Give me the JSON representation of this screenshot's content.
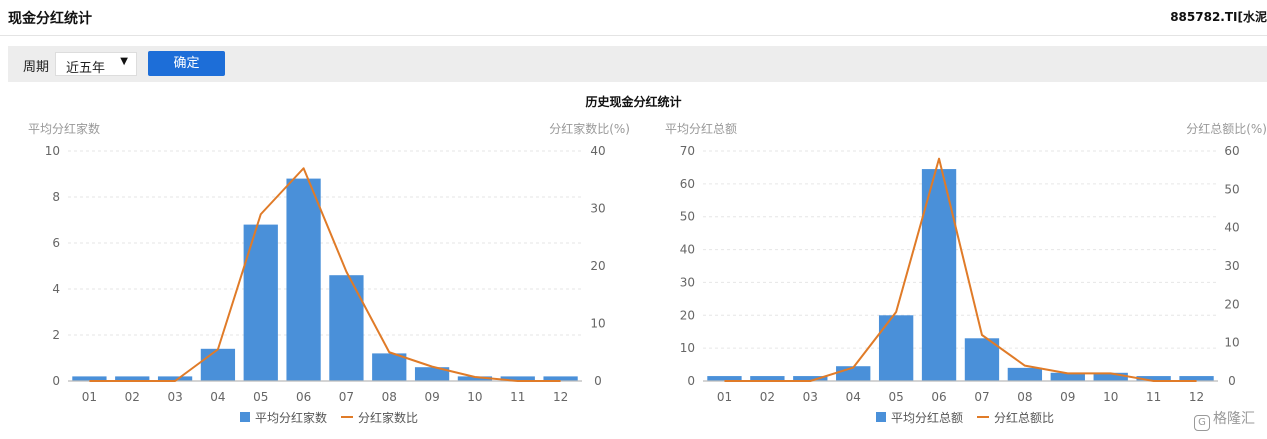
{
  "header": {
    "title": "现金分红统计",
    "code": "885782.TI[水泥"
  },
  "toolbar": {
    "period_label": "周期",
    "period_value": "近五年",
    "confirm_label": "确定"
  },
  "chart_title": "历史现金分红统计",
  "colors": {
    "bar": "#4a90d9",
    "line": "#e07b28",
    "button": "#1d6ed8"
  },
  "watermark": {
    "icon": "G",
    "text": "格隆汇"
  },
  "chart_data": [
    {
      "type": "bar",
      "categories": [
        "01",
        "02",
        "03",
        "04",
        "05",
        "06",
        "07",
        "08",
        "09",
        "10",
        "11",
        "12"
      ],
      "series": [
        {
          "name": "平均分红家数",
          "type": "bar",
          "axis": "left",
          "values": [
            0.2,
            0.2,
            0.2,
            1.4,
            6.8,
            8.8,
            4.6,
            1.2,
            0.6,
            0.2,
            0.2,
            0.2
          ]
        },
        {
          "name": "分红家数比",
          "type": "line",
          "axis": "right",
          "values": [
            0,
            0,
            0,
            5.5,
            29,
            37,
            19,
            5,
            2.5,
            0.7,
            0,
            0
          ]
        }
      ],
      "ylabel": "平均分红家数",
      "y2label": "分红家数比(%)",
      "ylim": [
        0,
        10
      ],
      "y2lim": [
        0,
        40
      ],
      "yticks": [
        0,
        2,
        4,
        6,
        8,
        10
      ],
      "y2ticks": [
        0,
        10,
        20,
        30,
        40
      ],
      "grid": true,
      "legend": "bottom"
    },
    {
      "type": "bar",
      "categories": [
        "01",
        "02",
        "03",
        "04",
        "05",
        "06",
        "07",
        "08",
        "09",
        "10",
        "11",
        "12"
      ],
      "series": [
        {
          "name": "平均分红总额",
          "type": "bar",
          "axis": "left",
          "values": [
            1.5,
            1.5,
            1.5,
            4.5,
            20,
            64.5,
            13,
            4,
            2.5,
            2.5,
            1.5,
            1.5
          ]
        },
        {
          "name": "分红总额比",
          "type": "line",
          "axis": "right",
          "values": [
            0,
            0,
            0,
            3.5,
            18,
            58,
            12,
            4,
            2,
            2,
            0,
            0
          ]
        }
      ],
      "ylabel": "平均分红总额",
      "y2label": "分红总额比(%)",
      "ylim": [
        0,
        70
      ],
      "y2lim": [
        0,
        60
      ],
      "yticks": [
        0,
        10,
        20,
        30,
        40,
        50,
        60,
        70
      ],
      "y2ticks": [
        0,
        10,
        20,
        30,
        40,
        50,
        60
      ],
      "grid": true,
      "legend": "bottom"
    }
  ]
}
